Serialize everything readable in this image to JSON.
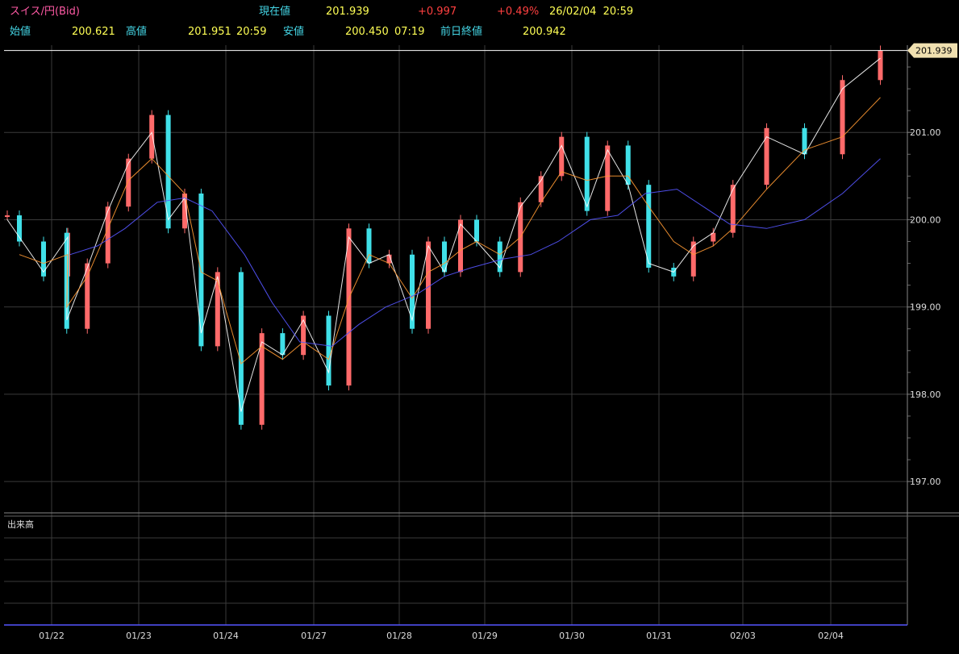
{
  "header": {
    "symbol": "スイス/円(Bid)",
    "current_label": "現在値",
    "current_value": "201.939",
    "change": "+0.997",
    "change_pct": "+0.49%",
    "datetime": "26/02/04  20:59",
    "open_label": "始値",
    "open_value": "200.621",
    "high_label": "高値",
    "high_value": "201.951",
    "high_time": "20:59",
    "low_label": "安値",
    "low_value": "200.450",
    "low_time": "07:19",
    "prev_close_label": "前日終値",
    "prev_close_value": "200.942"
  },
  "volume_label": "出来高",
  "colors": {
    "background": "#000000",
    "grid": "#3a3a3a",
    "bull": "#ff6a6a",
    "bear": "#40e0e8",
    "ma_short": "#ffffff",
    "ma_mid": "#ff9933",
    "ma_long": "#5555ff",
    "current_price_tag": "#f0e0b0"
  },
  "chart_data": {
    "type": "line",
    "title": "スイス/円(Bid)",
    "xlabel": "",
    "ylabel": "",
    "x_ticks": [
      "01/22",
      "01/23",
      "01/24",
      "01/27",
      "01/28",
      "01/29",
      "01/30",
      "01/31",
      "02/03",
      "02/04"
    ],
    "y_ticks": [
      "197.00",
      "198.00",
      "199.00",
      "200.00",
      "201.00"
    ],
    "ylim": [
      196.65,
      202.0
    ],
    "current_price": 201.939,
    "current_price_label": "201.939",
    "grid": true,
    "series": [
      {
        "name": "",
        "kind": "price",
        "x": [
          "01/21",
          "01/22",
          "01/22",
          "01/22",
          "01/23",
          "01/23",
          "01/23",
          "01/23",
          "01/24",
          "01/24",
          "01/24",
          "01/24",
          "01/24",
          "01/27",
          "01/27",
          "01/27",
          "01/27",
          "01/28",
          "01/28",
          "01/28",
          "01/28",
          "01/29",
          "01/29",
          "01/29",
          "01/29",
          "01/29",
          "01/30",
          "01/30",
          "01/30",
          "01/30",
          "01/31",
          "01/31",
          "01/31",
          "01/31",
          "02/03",
          "02/03",
          "02/03",
          "02/03",
          "02/04",
          "02/04",
          "02/04",
          "02/04"
        ],
        "values": [
          200.05,
          199.75,
          199.35,
          199.85,
          198.75,
          199.5,
          200.15,
          200.7,
          201.2,
          199.9,
          200.3,
          198.55,
          199.4,
          197.65,
          198.7,
          198.45,
          198.9,
          198.1,
          199.9,
          199.5,
          199.6,
          198.75,
          199.75,
          199.4,
          200.0,
          199.75,
          199.4,
          200.2,
          200.5,
          200.95,
          200.1,
          200.85,
          200.4,
          199.45,
          199.35,
          199.75,
          199.85,
          200.4,
          201.05,
          200.75,
          201.6,
          201.94
        ]
      },
      {
        "name": "",
        "kind": "ma_short",
        "x": [
          "01/21",
          "01/22",
          "01/22",
          "01/22",
          "01/23",
          "01/23",
          "01/23",
          "01/23",
          "01/24",
          "01/24",
          "01/24",
          "01/24",
          "01/24",
          "01/27",
          "01/27",
          "01/27",
          "01/27",
          "01/28",
          "01/28",
          "01/28",
          "01/28",
          "01/29",
          "01/29",
          "01/29",
          "01/29",
          "01/29",
          "01/30",
          "01/30",
          "01/30",
          "01/30",
          "01/31",
          "01/31",
          "01/31",
          "01/31",
          "02/03",
          "02/03",
          "02/03",
          "02/03",
          "02/04",
          "02/04",
          "02/04",
          "02/04"
        ],
        "values": [
          200.0,
          199.8,
          199.4,
          199.8,
          198.85,
          199.45,
          200.1,
          200.65,
          201.0,
          200.0,
          200.25,
          198.7,
          199.35,
          197.8,
          198.6,
          198.45,
          198.85,
          198.25,
          199.8,
          199.5,
          199.6,
          198.85,
          199.7,
          199.4,
          199.95,
          199.75,
          199.45,
          200.15,
          200.45,
          200.85,
          200.15,
          200.8,
          200.4,
          199.5,
          199.4,
          199.7,
          199.85,
          200.35,
          200.95,
          200.75,
          201.5,
          201.85
        ]
      },
      {
        "name": "",
        "kind": "ma_mid",
        "x": [
          "01/22",
          "01/22",
          "01/22",
          "01/23",
          "01/23",
          "01/23",
          "01/23",
          "01/24",
          "01/24",
          "01/24",
          "01/24",
          "01/24",
          "01/27",
          "01/27",
          "01/27",
          "01/27",
          "01/28",
          "01/28",
          "01/28",
          "01/28",
          "01/29",
          "01/29",
          "01/29",
          "01/29",
          "01/29",
          "01/30",
          "01/30",
          "01/30",
          "01/30",
          "01/31",
          "01/31",
          "01/31",
          "01/31",
          "02/03",
          "02/03",
          "02/03",
          "02/03",
          "02/04",
          "02/04",
          "02/04",
          "02/04"
        ],
        "values": [
          199.6,
          199.5,
          199.6,
          199.0,
          199.35,
          199.9,
          200.45,
          200.7,
          200.5,
          200.3,
          199.4,
          199.3,
          198.35,
          198.55,
          198.4,
          198.6,
          198.4,
          199.1,
          199.6,
          199.5,
          199.1,
          199.4,
          199.5,
          199.65,
          199.75,
          199.6,
          199.8,
          200.2,
          200.55,
          200.45,
          200.5,
          200.5,
          200.15,
          199.75,
          199.6,
          199.7,
          199.9,
          200.35,
          200.8,
          200.95,
          201.4
        ]
      },
      {
        "name": "",
        "kind": "ma_long",
        "x": [
          "01/23",
          "01/23",
          "01/23",
          "01/24",
          "01/24",
          "01/24",
          "01/27",
          "01/27",
          "01/27",
          "01/28",
          "01/28",
          "01/28",
          "01/29",
          "01/29",
          "01/29",
          "01/30",
          "01/30",
          "01/30",
          "01/31",
          "01/31",
          "01/31",
          "02/03",
          "02/03",
          "02/03",
          "02/04",
          "02/04",
          "02/04",
          "02/04"
        ],
        "values": [
          199.6,
          199.7,
          199.9,
          200.2,
          200.25,
          200.1,
          199.6,
          199.05,
          198.6,
          198.55,
          198.8,
          199.0,
          199.15,
          199.35,
          199.45,
          199.55,
          199.6,
          199.75,
          200.0,
          200.05,
          200.3,
          200.35,
          200.15,
          199.95,
          199.9,
          200.0,
          200.3,
          200.7
        ]
      }
    ]
  }
}
